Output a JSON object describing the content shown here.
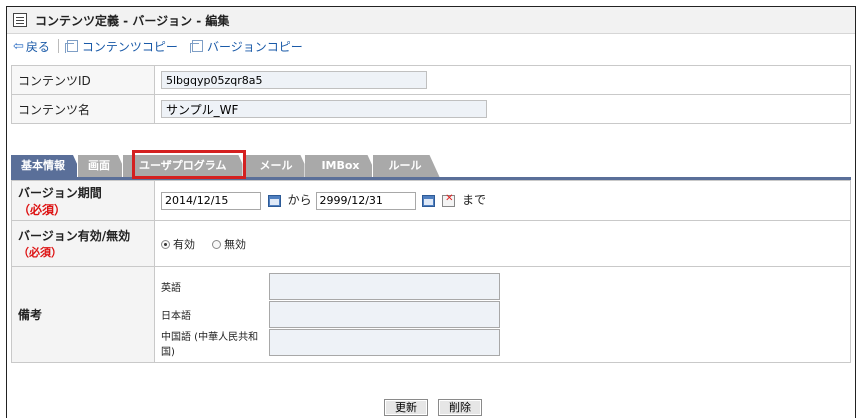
{
  "window": {
    "title": "コンテンツ定義 - バージョン - 編集"
  },
  "toolbar": {
    "back": "戻る",
    "content_copy": "コンテンツコピー",
    "version_copy": "バージョンコピー"
  },
  "info": {
    "content_id_label": "コンテンツID",
    "content_id_value": "5lbgqyp05zqr8a5",
    "content_name_label": "コンテンツ名",
    "content_name_value": "サンプル_WF"
  },
  "tabs": [
    {
      "label": "基本情報",
      "active": true
    },
    {
      "label": "画面",
      "active": false
    },
    {
      "label": "ユーザプログラム",
      "active": false
    },
    {
      "label": "メール",
      "active": false
    },
    {
      "label": "IMBox",
      "active": false
    },
    {
      "label": "ルール",
      "active": false
    }
  ],
  "form": {
    "period_label": "バージョン期間",
    "period_required": "（必須）",
    "start_date": "2014/12/15",
    "from_text": "から",
    "end_date": "2999/12/31",
    "until_text": "まで",
    "validity_label": "バージョン有効/無効",
    "validity_required": "（必須）",
    "valid_label": "有効",
    "invalid_label": "無効",
    "validity_selected": "有効",
    "remarks_label": "備考",
    "remarks": [
      {
        "lang": "英語"
      },
      {
        "lang": "日本語"
      },
      {
        "lang": "中国語 (中華人民共和国)"
      }
    ]
  },
  "buttons": {
    "update": "更新",
    "delete": "削除"
  },
  "colors": {
    "tab_active": "#5a6f99",
    "tab_inactive": "#a9a9a9",
    "highlight": "#d42020",
    "required": "#dd1111",
    "link": "#1a5aa8"
  }
}
